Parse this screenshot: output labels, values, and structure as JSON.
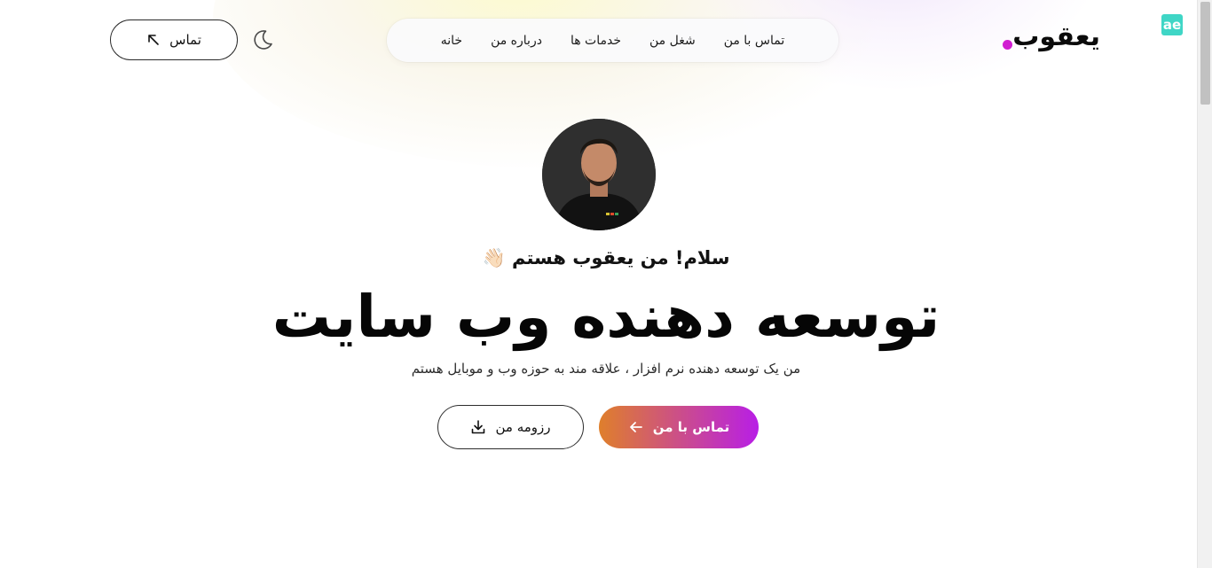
{
  "browser": {
    "extension_icon": "ae",
    "extension_icon_name": "aesthetic-extension-icon"
  },
  "header": {
    "logo_text": "یعقوب",
    "logo_dot_color": "#d11ed1",
    "nav": [
      {
        "label": "خانه"
      },
      {
        "label": "درباره من"
      },
      {
        "label": "خدمات ها"
      },
      {
        "label": "شغل من"
      },
      {
        "label": "تماس با من"
      }
    ],
    "theme_toggle_icon": "moon-icon",
    "contact_button": {
      "label": "تماس",
      "icon": "arrow-up-left-icon"
    }
  },
  "hero": {
    "avatar_alt": "profile photo",
    "greeting": "سلام! من یعقوب هستم",
    "greeting_emoji": "👋🏻",
    "headline": "توسعه دهنده وب سایت",
    "subtitle": "من یک توسعه دهنده نرم افزار ، علاقه مند به حوزه وب و موبایل هستم",
    "primary_button": {
      "label": "تماس با من",
      "icon": "arrow-left-icon",
      "gradient_start": "#df7f2b",
      "gradient_end": "#b81ee6"
    },
    "secondary_button": {
      "label": "رزومه من",
      "icon": "download-icon"
    }
  }
}
